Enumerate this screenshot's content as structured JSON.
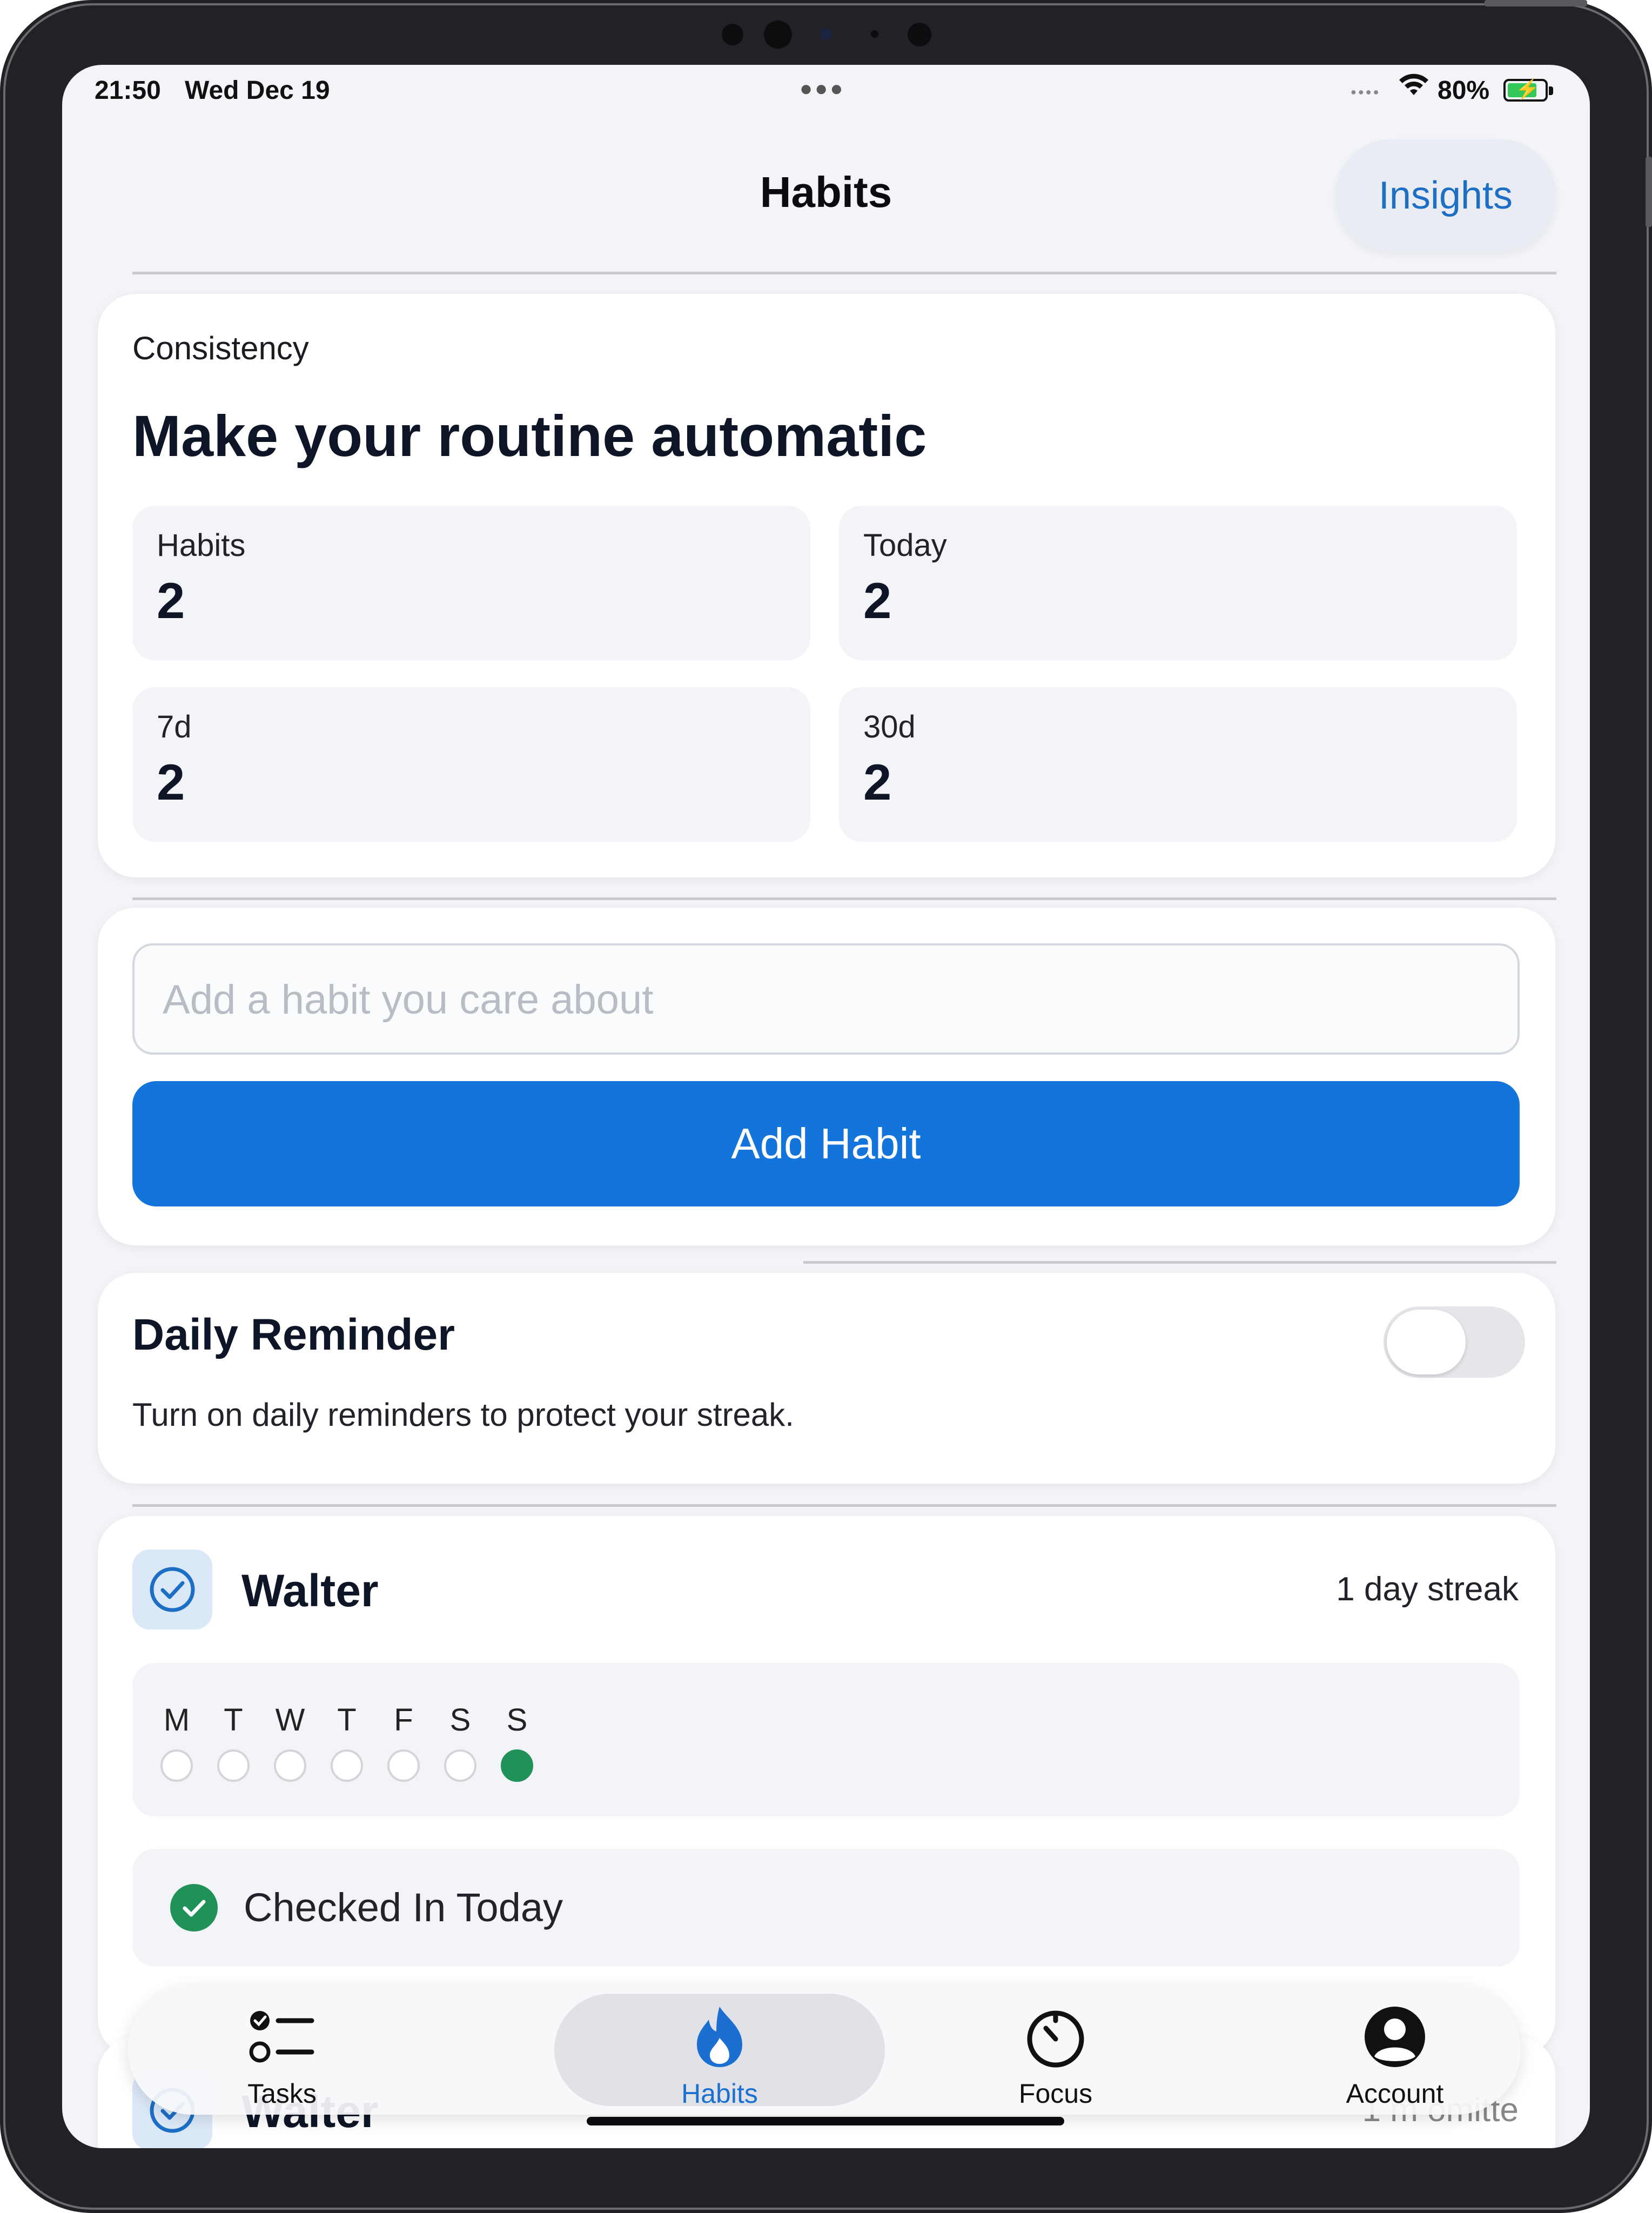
{
  "status_bar": {
    "time": "21:50",
    "date": "Wed Dec 19",
    "battery": "80%",
    "battery_level": 0.8
  },
  "nav": {
    "title": "Habits",
    "insights_label": "Insights"
  },
  "summary": {
    "eyebrow": "Consistency",
    "headline": "Make your routine automatic",
    "stats": [
      {
        "label": "Habits",
        "value": "2"
      },
      {
        "label": "Today",
        "value": "2"
      },
      {
        "label": "7d",
        "value": "2"
      },
      {
        "label": "30d",
        "value": "2"
      }
    ]
  },
  "add_habit": {
    "placeholder": "Add a habit you care about",
    "value": "",
    "button_label": "Add Habit"
  },
  "reminder": {
    "title": "Daily Reminder",
    "description": "Turn on daily reminders to protect your streak.",
    "enabled": false
  },
  "habits": [
    {
      "name": "Walter",
      "streak": "1 day streak",
      "days": [
        "M",
        "T",
        "W",
        "T",
        "F",
        "S",
        "S"
      ],
      "completed": [
        false,
        false,
        false,
        false,
        false,
        false,
        true
      ],
      "checkin_label": "Checked In Today"
    },
    {
      "name": "Walter",
      "streak": "1 m omitte"
    }
  ],
  "tabs": [
    {
      "label": "Tasks",
      "icon": "tasks-icon"
    },
    {
      "label": "Habits",
      "icon": "flame-icon",
      "active": true
    },
    {
      "label": "Focus",
      "icon": "timer-icon"
    },
    {
      "label": "Account",
      "icon": "account-icon"
    }
  ],
  "colors": {
    "accent": "#1374dc",
    "success": "#209258",
    "background": "#f3f4f8"
  }
}
